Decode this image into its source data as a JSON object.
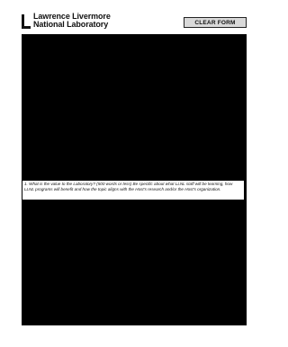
{
  "header": {
    "logo_line1": "Lawrence Livermore",
    "logo_line2": "National Laboratory",
    "clear_button_label": "CLEAR FORM"
  },
  "form": {
    "question_1": "1. What is the value to the Laboratory? (500 words or less) Be specific about what LLNL staff will be learning, how LLNL programs will benefit and how the topic aligns with the Host's research and/or the Host's organization."
  }
}
